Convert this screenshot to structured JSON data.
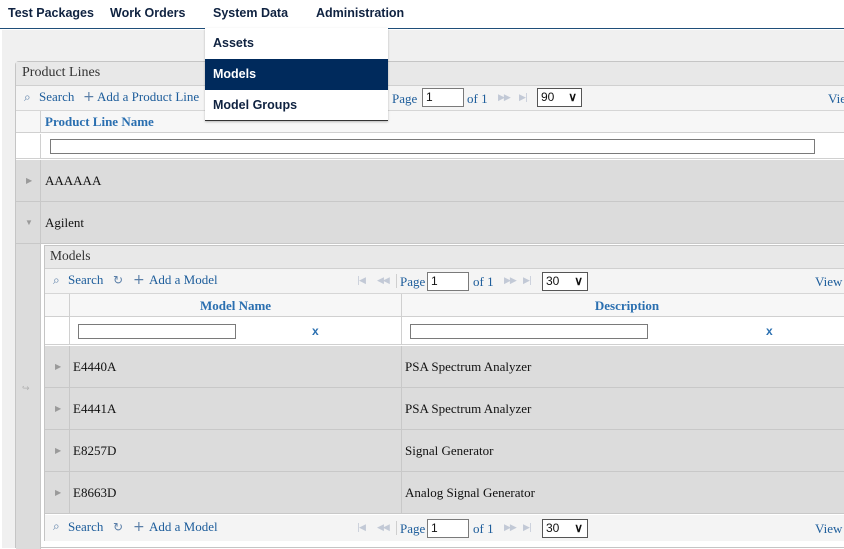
{
  "menu": {
    "items": [
      "Test Packages",
      "Work Orders",
      "System Data",
      "Administration"
    ],
    "dropdown": [
      "Assets",
      "Models",
      "Model Groups"
    ],
    "active_dropdown": "Models"
  },
  "product_lines": {
    "caption": "Product Lines",
    "toolbar": {
      "search": "Search",
      "add": "Add a Product Line",
      "page_label": "Page",
      "page_value": "1",
      "of_label": "of 1",
      "page_size": "90",
      "view_label": "Vie"
    },
    "column": "Product Line Name",
    "rows": [
      "AAAAAA",
      "Agilent"
    ]
  },
  "models": {
    "caption": "Models",
    "toolbar": {
      "search": "Search",
      "add": "Add a Model",
      "page_label": "Page",
      "page_value": "1",
      "of_label": "of 1",
      "page_size": "30",
      "view_label": "View"
    },
    "columns": [
      "Model Name",
      "Description"
    ],
    "clear": "x",
    "rows": [
      {
        "name": "E4440A",
        "description": "PSA Spectrum Analyzer"
      },
      {
        "name": "E4441A",
        "description": "PSA Spectrum Analyzer"
      },
      {
        "name": "E8257D",
        "description": "Signal Generator"
      },
      {
        "name": "E8663D",
        "description": "Analog Signal Generator"
      }
    ],
    "footer": {
      "search": "Search",
      "add": "Add a Model",
      "page_label": "Page",
      "page_value": "1",
      "of_label": "of 1",
      "page_size": "30",
      "view_label": "View"
    }
  },
  "colors": {
    "menu_text": "#0f2240",
    "active_menu_bg": "#002a5c",
    "link": "#1d5d9b",
    "header_text": "#2a6fb0",
    "row_bg": "#dcdcdc"
  },
  "icons": [
    "search-icon",
    "plus-icon",
    "refresh-icon",
    "first-page-icon",
    "prev-page-icon",
    "next-page-icon",
    "last-page-icon",
    "expand-icon",
    "collapse-icon",
    "subgrid-icon"
  ]
}
